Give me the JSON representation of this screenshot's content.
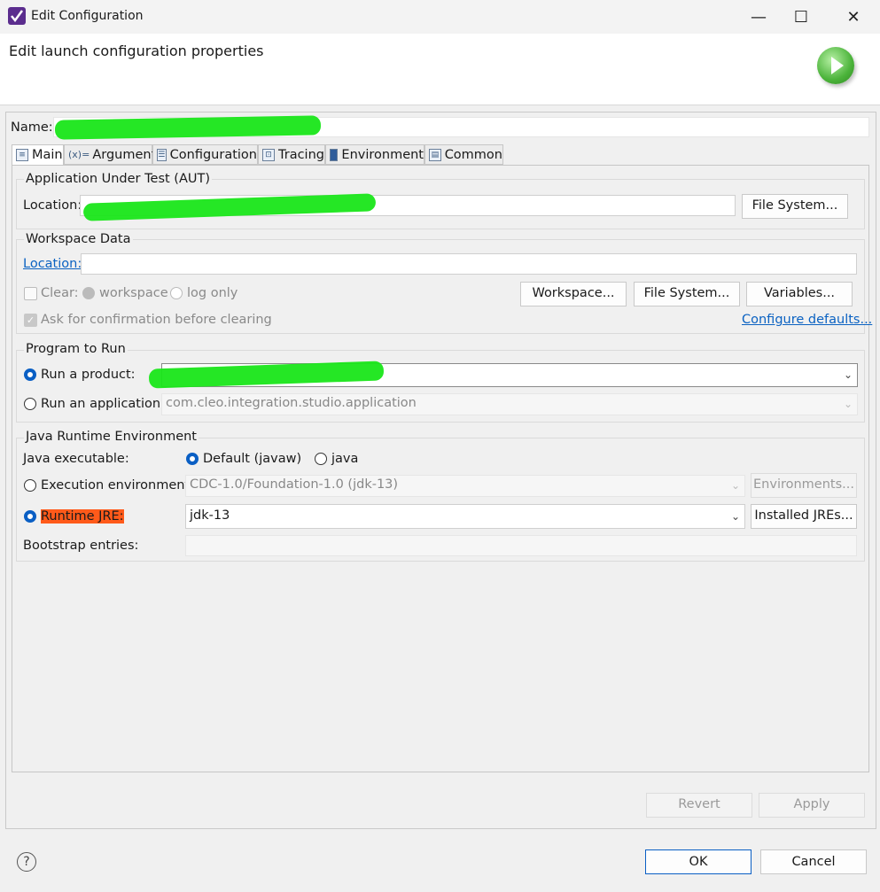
{
  "window": {
    "title": "Edit Configuration",
    "minimize": "—",
    "maximize": "☐",
    "close": "✕"
  },
  "header": {
    "title": "Edit launch configuration properties"
  },
  "name_field": {
    "label": "Name:",
    "value": ""
  },
  "tabs": [
    {
      "label": "Main",
      "icon": "main-tab-icon"
    },
    {
      "label": "Arguments",
      "icon": "arguments-tab-icon"
    },
    {
      "label": "Configuration",
      "icon": "configuration-tab-icon"
    },
    {
      "label": "Tracing",
      "icon": "tracing-tab-icon"
    },
    {
      "label": "Environment",
      "icon": "environment-tab-icon"
    },
    {
      "label": "Common",
      "icon": "common-tab-icon"
    }
  ],
  "aut": {
    "group_label": "Application Under Test (AUT)",
    "location_label": "Location:",
    "location_value": "",
    "file_system": "File System..."
  },
  "workspace": {
    "group_label": "Workspace Data",
    "location_label": "Location:",
    "location_value": "",
    "clear_label": "Clear:",
    "workspace_option": "workspace",
    "log_only_option": "log only",
    "workspace_button": "Workspace...",
    "file_system_button": "File System...",
    "variables_button": "Variables...",
    "confirm_label": "Ask for confirmation before clearing",
    "configure_defaults": "Configure defaults..."
  },
  "program": {
    "group_label": "Program to Run",
    "run_product_label": "Run a product:",
    "run_product_value": "",
    "run_application_label": "Run an application:",
    "run_application_value": "com.cleo.integration.studio.application"
  },
  "jre": {
    "group_label": "Java Runtime Environment",
    "java_executable_label": "Java executable:",
    "default_option": "Default (javaw)",
    "java_option": "java",
    "execution_env_label": "Execution environment:",
    "execution_env_value": "CDC-1.0/Foundation-1.0 (jdk-13)",
    "environments_button": "Environments...",
    "runtime_jre_label": "Runtime JRE:",
    "runtime_jre_value": "jdk-13",
    "installed_jres_button": "Installed JREs...",
    "bootstrap_label": "Bootstrap entries:"
  },
  "footer": {
    "revert": "Revert",
    "apply": "Apply",
    "ok": "OK",
    "cancel": "Cancel",
    "help": "?"
  },
  "colors": {
    "accent": "#0a5fc4",
    "highlight": "#ff5a1a",
    "redaction": "#19e619"
  }
}
